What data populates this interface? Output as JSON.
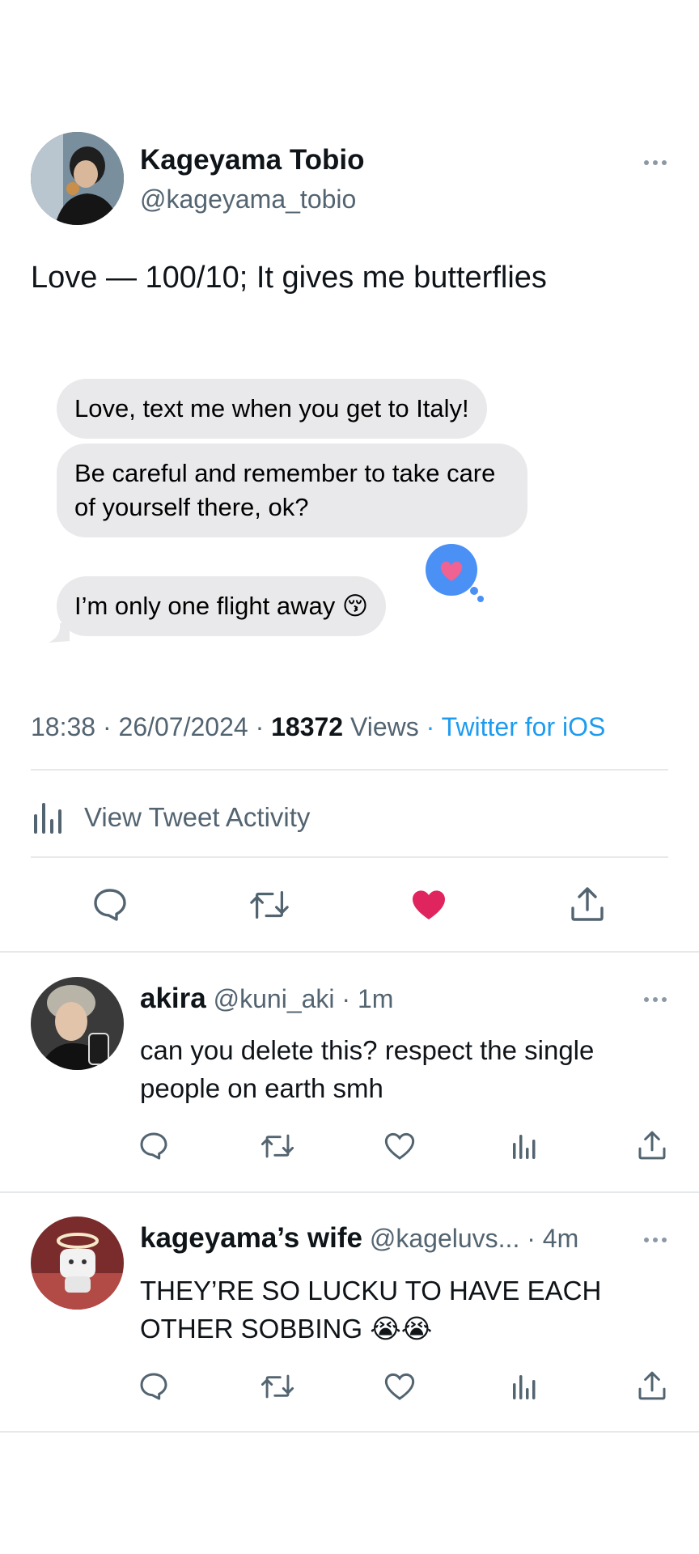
{
  "tweet": {
    "author_name": "Kageyama Tobio",
    "author_handle": "@kageyama_tobio",
    "text": "Love — 100/10; It gives me butterflies",
    "time": "18:38",
    "sep": " · ",
    "date": "26/07/2024",
    "views_count": "18372",
    "views_label": "Views",
    "source": "· Twitter for iOS",
    "activity_label": "View Tweet Activity"
  },
  "messages": [
    "Love, text me when you get to Italy!",
    "Be careful and remember to take care of yourself there, ok?",
    "I’m only one flight away 😚"
  ],
  "replies": [
    {
      "name": "akira",
      "handle": "@kuni_aki",
      "time": "· 1m",
      "text": "can you delete this? respect the single people on earth smh"
    },
    {
      "name": "kageyama’s wife",
      "handle": "@kageluvs...",
      "time": "· 4m",
      "text": "THEY’RE SO LUCKU TO HAVE EACH OTHER SOBBING 😭😭"
    }
  ],
  "colors": {
    "like_active": "#e0245e",
    "link": "#1d9bf0",
    "bubble": "#e9e9eb",
    "reaction": "#4a90f5"
  }
}
